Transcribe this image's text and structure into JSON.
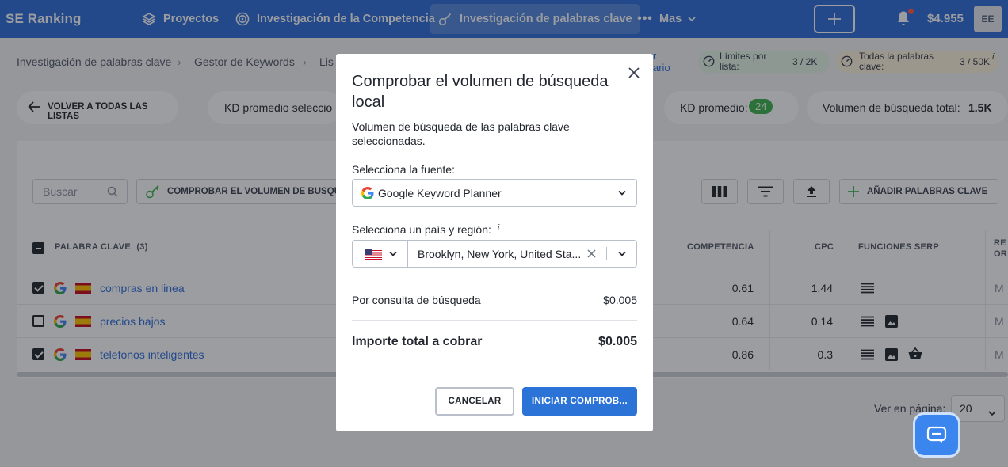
{
  "nav": {
    "logo": "SE Ranking",
    "items": [
      {
        "label": "Proyectos"
      },
      {
        "label": "Investigación de la Competencia"
      },
      {
        "label": "Investigación de palabras clave"
      },
      {
        "label": "Mas"
      }
    ],
    "balance": "$4.955",
    "avatar": "EE"
  },
  "breadcrumb": [
    "Investigación de palabras clave",
    "Gestor de Keywords",
    "Lis"
  ],
  "limits": {
    "partial_link": "r\nario",
    "per_list_label": "Límites por lista:",
    "per_list_value": "3 / 2K",
    "all_label": "Todas la palabras clave:",
    "all_value": "3 / 50K",
    "info": "i"
  },
  "toolbar": {
    "back": "VOLVER A TODAS LAS LISTAS",
    "kd_selected": "KD promedio seleccio",
    "kd_avg_label": "KD promedio:",
    "kd_avg_value": "24",
    "volume_label": "Volumen de búsqueda total:",
    "volume_value": "1.5K"
  },
  "table_tools": {
    "search_placeholder": "Buscar",
    "check_volume": "COMPROBAR EL VOLUMEN DE BÚSQUED",
    "add_keywords": "AÑADIR PALABRAS CLAVE"
  },
  "table": {
    "headers": {
      "keyword": "PALABRA CLAVE",
      "count": "(3)",
      "competition": "COMPETENCIA",
      "cpc": "CPC",
      "serp": "FUNCIONES SERP",
      "extra1": "RE",
      "extra2": "OR"
    },
    "rows": [
      {
        "keyword": "compras en linea",
        "competition": "0.61",
        "cpc": "1.44",
        "checked": true,
        "cut": "M"
      },
      {
        "keyword": "precios bajos",
        "competition": "0.64",
        "cpc": "0.14",
        "checked": false,
        "cut": "M"
      },
      {
        "keyword": "telefonos inteligentes",
        "competition": "0.86",
        "cpc": "0.3",
        "checked": true,
        "cut": "M"
      }
    ]
  },
  "pagination": {
    "label": "Ver en página:",
    "value": "20"
  },
  "modal": {
    "title": "Comprobar el volumen de búsqueda local",
    "description": "Volumen de búsqueda de las palabras clave seleccionadas.",
    "source_label": "Selecciona la fuente:",
    "source_value": "Google Keyword Planner",
    "region_label": "Selecciona un país y región:",
    "region_info": "i",
    "region_value": "Brooklyn, New York, United Sta...",
    "per_query_label": "Por consulta de búsqueda",
    "per_query_value": "$0.005",
    "total_label": "Importe total a cobrar",
    "total_value": "$0.005",
    "cancel": "CANCELAR",
    "start": "INICIAR COMPROB..."
  },
  "colors": {
    "brand": "#2f6fdb",
    "primary_button": "#2b73d6",
    "kd_badge": "#3fb34f"
  }
}
